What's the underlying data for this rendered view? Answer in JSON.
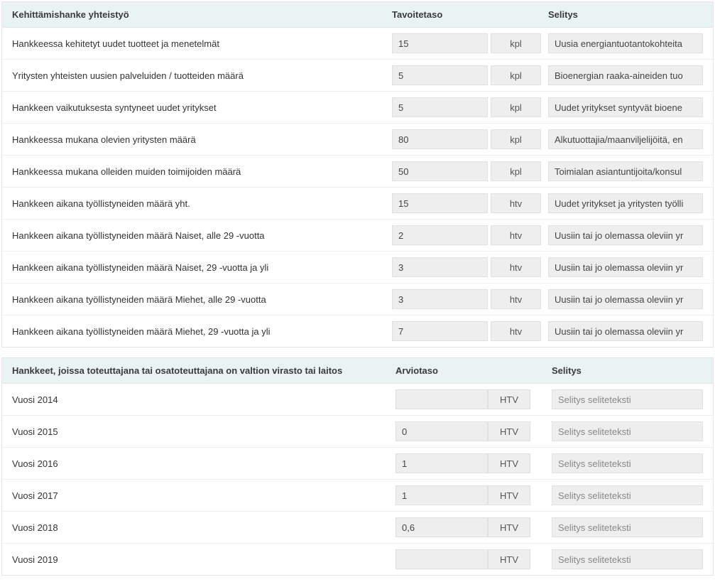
{
  "table1": {
    "headers": {
      "label": "Kehittämishanke yhteistyö",
      "value": "Tavoitetaso",
      "desc": "Selitys"
    },
    "rows": [
      {
        "label": "Hankkeessa kehitetyt uudet tuotteet ja menetelmät",
        "value": "15",
        "unit": "kpl",
        "desc": "Uusia energiantuotantokohteita"
      },
      {
        "label": "Yritysten yhteisten uusien palveluiden / tuotteiden määrä",
        "value": "5",
        "unit": "kpl",
        "desc": "Bioenergian raaka-aineiden tuo"
      },
      {
        "label": "Hankkeen vaikutuksesta syntyneet uudet yritykset",
        "value": "5",
        "unit": "kpl",
        "desc": "Uudet yritykset syntyvät bioene"
      },
      {
        "label": "Hankkeessa mukana olevien yritysten määrä",
        "value": "80",
        "unit": "kpl",
        "desc": "Alkutuottajia/maanviljelijöitä, en"
      },
      {
        "label": "Hankkeessa mukana olleiden muiden toimijoiden määrä",
        "value": "50",
        "unit": "kpl",
        "desc": "Toimialan asiantuntijoita/konsul"
      },
      {
        "label": "Hankkeen aikana työllistyneiden määrä yht.",
        "value": "15",
        "unit": "htv",
        "desc": "Uudet yritykset ja yritysten työlli"
      },
      {
        "label": "Hankkeen aikana työllistyneiden määrä Naiset, alle 29 -vuotta",
        "value": "2",
        "unit": "htv",
        "desc": "Uusiin tai jo olemassa oleviin yr"
      },
      {
        "label": "Hankkeen aikana työllistyneiden määrä Naiset, 29 -vuotta ja yli",
        "value": "3",
        "unit": "htv",
        "desc": "Uusiin tai jo olemassa oleviin yr"
      },
      {
        "label": "Hankkeen aikana työllistyneiden määrä Miehet, alle 29 -vuotta",
        "value": "3",
        "unit": "htv",
        "desc": "Uusiin tai jo olemassa oleviin yr"
      },
      {
        "label": "Hankkeen aikana työllistyneiden määrä Miehet, 29 -vuotta ja yli",
        "value": "7",
        "unit": "htv",
        "desc": "Uusiin tai jo olemassa oleviin yr"
      }
    ]
  },
  "table2": {
    "headers": {
      "label": "Hankkeet, joissa toteuttajana tai osatoteuttajana on valtion virasto tai laitos",
      "value": "Arviotaso",
      "desc": "Selitys"
    },
    "rows": [
      {
        "label": "Vuosi 2014",
        "value": "",
        "unit": "HTV",
        "desc": "",
        "placeholder": "Selitys seliteteksti"
      },
      {
        "label": "Vuosi 2015",
        "value": "0",
        "unit": "HTV",
        "desc": "",
        "placeholder": "Selitys seliteteksti"
      },
      {
        "label": "Vuosi 2016",
        "value": "1",
        "unit": "HTV",
        "desc": "",
        "placeholder": "Selitys seliteteksti"
      },
      {
        "label": "Vuosi 2017",
        "value": "1",
        "unit": "HTV",
        "desc": "",
        "placeholder": "Selitys seliteteksti"
      },
      {
        "label": "Vuosi 2018",
        "value": "0,6",
        "unit": "HTV",
        "desc": "",
        "placeholder": "Selitys seliteteksti"
      },
      {
        "label": "Vuosi 2019",
        "value": "",
        "unit": "HTV",
        "desc": "",
        "placeholder": "Selitys seliteteksti"
      }
    ]
  }
}
